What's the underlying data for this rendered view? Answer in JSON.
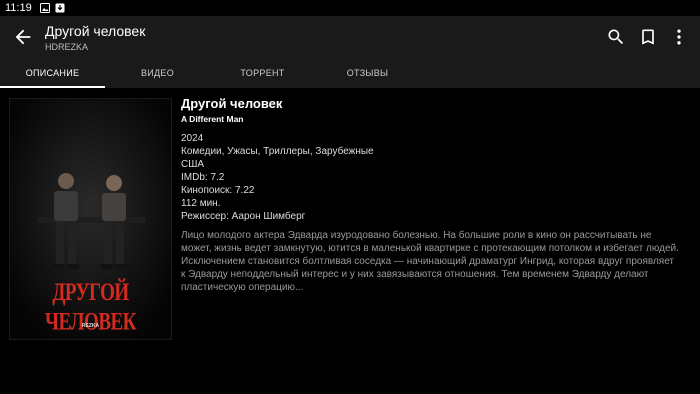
{
  "status_bar": {
    "time": "11:19"
  },
  "app_bar": {
    "title": "Другой человек",
    "subtitle": "HDREZKA"
  },
  "tabs": [
    {
      "label": "ОПИСАНИЕ",
      "active": true
    },
    {
      "label": "ВИДЕО"
    },
    {
      "label": "ТОРРЕНТ"
    },
    {
      "label": "ОТЗЫВЫ"
    }
  ],
  "poster": {
    "title_text": "ДРУГОЙ ЧЕЛОВЕК",
    "logo_text": "REZKA"
  },
  "movie": {
    "title": "Другой человек",
    "original_title": "A Different Man",
    "year": "2024",
    "genres": "Комедии, Ужасы, Триллеры, Зарубежные",
    "country": "США",
    "imdb": "IMDb: 7.2",
    "kinopoisk": "Кинопоиск: 7.22",
    "duration": "112 мин.",
    "director": "Режиссер: Аарон Шимберг",
    "description_lines": [
      "Лицо молодого актера Эдварда изуродовано болезнью. На большие роли в кино он рассчитывать не",
      "может, жизнь ведет замкнутую, ютится в маленькой квартирке с протекающим потолком и избегает людей.",
      "Исключением становится болтливая соседка — начинающий драматург Ингрид, которая вдруг проявляет",
      "к Эдварду неподдельный интерес и у них завязываются отношения. Тем временем Эдварду делают",
      "пластическую операцию..."
    ]
  },
  "colors": {
    "background": "#000000",
    "app_bar": "#1a1a1a",
    "poster_title": "#d42a1f"
  }
}
